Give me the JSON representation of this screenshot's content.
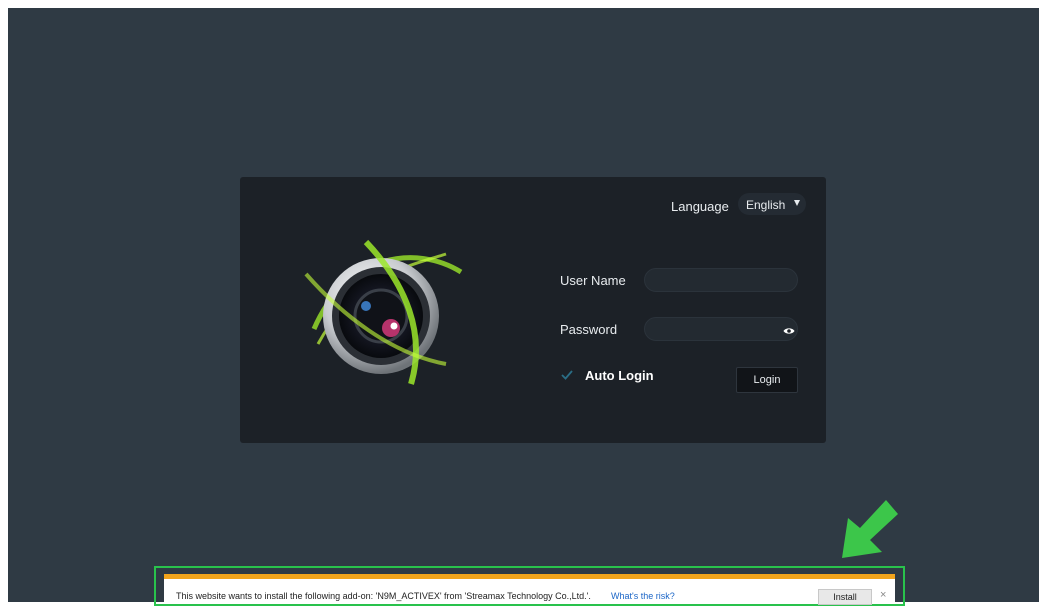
{
  "login": {
    "language_label": "Language",
    "language_value": "English",
    "username_label": "User Name",
    "username_value": "",
    "password_label": "Password",
    "password_value": "",
    "auto_login_label": "Auto Login",
    "auto_login_checked": true,
    "login_button": "Login"
  },
  "notification": {
    "message": "This website wants to install the following add-on: 'N9M_ACTIVEX' from 'Streamax Technology Co.,Ltd.'.",
    "risk_link": "What's the risk?",
    "install_button": "Install",
    "close_symbol": "×"
  },
  "icons": {
    "logo": "camera-lens-logo",
    "dropdown": "caret-down-icon",
    "password_toggle": "eye-icon",
    "checkbox": "checkmark-icon",
    "annotation": "green-arrow-icon"
  },
  "colors": {
    "background": "#2f3a44",
    "panel": "#1c2127",
    "accent_green": "#29c24c",
    "notification_bar": "#f2a41c",
    "link": "#1b66c7"
  }
}
